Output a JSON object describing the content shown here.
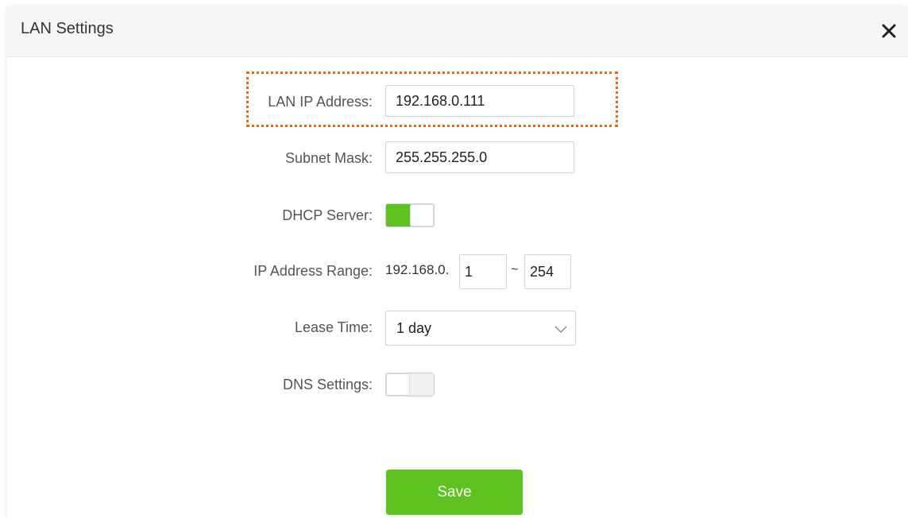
{
  "dialog": {
    "title": "LAN Settings",
    "close_icon": "close-icon"
  },
  "form": {
    "lan_ip": {
      "label": "LAN IP Address:",
      "value": "192.168.0.111"
    },
    "subnet_mask": {
      "label": "Subnet Mask:",
      "value": "255.255.255.0"
    },
    "dhcp_server": {
      "label": "DHCP Server:",
      "enabled": true
    },
    "ip_range": {
      "label": "IP Address Range:",
      "prefix": "192.168.0.",
      "start": "1",
      "separator": "~",
      "end": "254"
    },
    "lease_time": {
      "label": "Lease Time:",
      "selected": "1 day"
    },
    "dns_settings": {
      "label": "DNS Settings:",
      "enabled": false
    }
  },
  "actions": {
    "save_label": "Save"
  },
  "colors": {
    "accent_green": "#5ec21f",
    "highlight_orange": "#e8651a"
  }
}
